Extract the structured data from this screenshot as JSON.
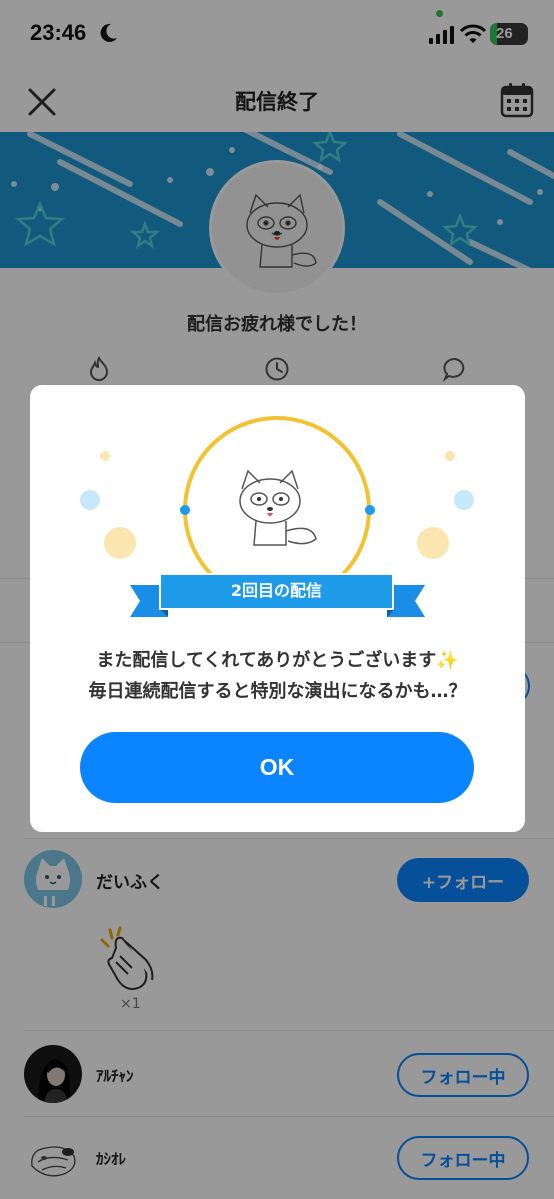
{
  "status_bar": {
    "time": "23:46",
    "battery": "26"
  },
  "header": {
    "title": "配信終了"
  },
  "summary": {
    "thanks_text": "配信お疲れ様でした！"
  },
  "users": [
    {
      "name": "だいふく",
      "follow_label": "+フォロー"
    },
    {
      "name": "ｱﾙﾁｬﾝ",
      "follow_label": "フォロー中"
    },
    {
      "name": "ｶｼｵﾚ",
      "follow_label": "フォロー中"
    }
  ],
  "gift": {
    "count": "×1"
  },
  "modal": {
    "ribbon_text": "2回目の配信",
    "message_line1": "また配信してくれてありがとうございます✨",
    "message_line2": "毎日連続配信すると特別な演出になるかも…？",
    "ok_label": "OK"
  },
  "colors": {
    "accent": "#0a84ff",
    "banner": "#1f95d3",
    "ring": "#f2c230"
  }
}
